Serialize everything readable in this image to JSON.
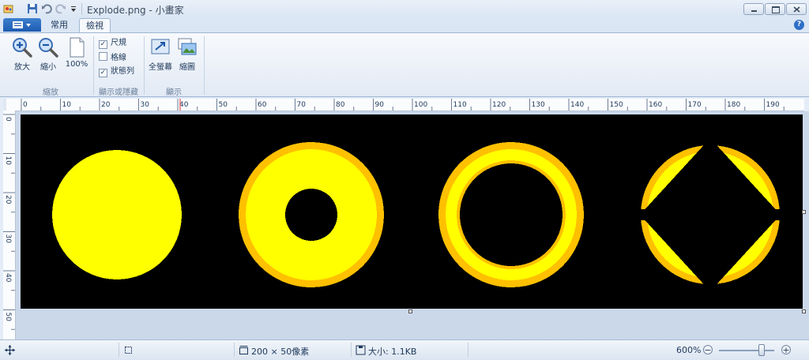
{
  "window": {
    "title": "Explode.png - 小畫家"
  },
  "tabs": {
    "home": "常用",
    "view": "檢視"
  },
  "ribbon": {
    "zoom_group": {
      "label": "縮放",
      "zoom_in": "放大",
      "zoom_out": "縮小",
      "actual_size": "100%"
    },
    "show_group": {
      "label": "顯示或隱藏",
      "rulers": {
        "label": "尺規",
        "checked": true
      },
      "gridlines": {
        "label": "格線",
        "checked": false
      },
      "statusbar": {
        "label": "狀態列",
        "checked": true
      }
    },
    "display_group": {
      "label": "顯示",
      "fullscreen": "全螢幕",
      "thumbnail": "縮圖"
    }
  },
  "ruler": {
    "h_ticks": [
      "0",
      "10",
      "20",
      "30",
      "40",
      "50",
      "60",
      "70",
      "80",
      "90",
      "100",
      "110",
      "120",
      "130",
      "140",
      "150",
      "160",
      "170",
      "180",
      "190"
    ],
    "v_ticks": [
      "0",
      "10",
      "20",
      "30",
      "40",
      "50"
    ]
  },
  "status": {
    "dimensions": "200 × 50像素",
    "size": "大小: 1.1KB",
    "zoom": "600%",
    "zoom_level": 0.75
  },
  "colors": {
    "yellow": "#ffff00",
    "orange": "#ffc000",
    "canvas_bg": "#000000"
  }
}
